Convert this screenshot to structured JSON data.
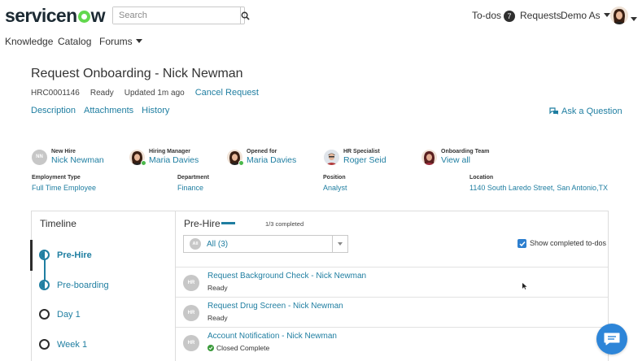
{
  "header": {
    "logo_text_1": "servicen",
    "logo_text_2": "w",
    "search_placeholder": "Search",
    "todos_label": "To-dos",
    "todos_count": "7",
    "requests_label": "Requests",
    "user_label": "Demo As"
  },
  "subnav": {
    "knowledge": "Knowledge",
    "catalog": "Catalog",
    "forums": "Forums"
  },
  "request": {
    "title": "Request Onboarding - Nick Newman",
    "number": "HRC0001146",
    "state": "Ready",
    "updated": "Updated 1m ago",
    "cancel_label": "Cancel Request"
  },
  "tabs": {
    "description": "Description",
    "attachments": "Attachments",
    "history": "History"
  },
  "ask_question": "Ask a Question",
  "people": {
    "new_hire": {
      "label": "New Hire",
      "value": "Nick Newman",
      "initials": "NN"
    },
    "hiring_manager": {
      "label": "Hiring Manager",
      "value": "Maria Davies"
    },
    "opened_for": {
      "label": "Opened for",
      "value": "Maria Davies"
    },
    "hr_specialist": {
      "label": "HR Specialist",
      "value": "Roger Seid"
    },
    "onboarding_team": {
      "label": "Onboarding Team",
      "value": "View all"
    }
  },
  "fields": {
    "employment_type": {
      "label": "Employment Type",
      "value": "Full Time Employee"
    },
    "department": {
      "label": "Department",
      "value": "Finance"
    },
    "position": {
      "label": "Position",
      "value": "Analyst"
    },
    "location": {
      "label": "Location",
      "value": "1140 South Laredo Street, San Antonio,TX"
    }
  },
  "timeline": {
    "title": "Timeline",
    "items": [
      {
        "label": "Pre-Hire",
        "state": "active"
      },
      {
        "label": "Pre-boarding",
        "state": "in-progress"
      },
      {
        "label": "Day 1",
        "state": "upcoming"
      },
      {
        "label": "Week 1",
        "state": "upcoming"
      }
    ]
  },
  "prehire": {
    "title": "Pre-Hire",
    "completed": "1/3 completed",
    "filter_initials": "All",
    "filter_label": "All (3)",
    "show_completed_label": "Show completed to-dos",
    "show_completed_checked": true,
    "todos": [
      {
        "initials": "HR",
        "title": "Request Background Check - Nick Newman",
        "status": "Ready"
      },
      {
        "initials": "HR",
        "title": "Request Drug Screen - Nick Newman",
        "status": "Ready"
      },
      {
        "initials": "HR",
        "title": "Account Notification - Nick Newman",
        "status": "Closed Complete"
      }
    ]
  },
  "colors": {
    "link": "#1f7ea1",
    "brand_green": "#62d84e",
    "chat_button": "#2d85d8",
    "checkbox": "#2d7fcf"
  }
}
